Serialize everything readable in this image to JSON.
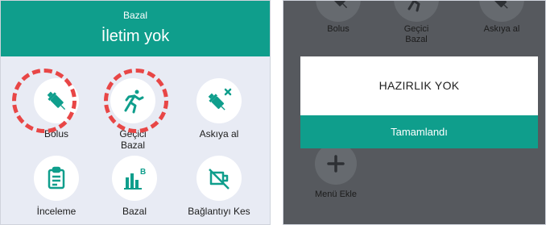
{
  "left": {
    "header_subtitle": "Bazal",
    "header_title": "İletim yok",
    "tiles": [
      {
        "label": "Bolus",
        "icon": "syringe-icon"
      },
      {
        "label": "Geçici",
        "label2": "Bazal",
        "icon": "running-person-icon"
      },
      {
        "label": "Askıya al",
        "icon": "syringe-pause-icon"
      },
      {
        "label": "İnceleme",
        "icon": "clipboard-icon"
      },
      {
        "label": "Bazal",
        "icon": "bar-chart-b-icon"
      },
      {
        "label": "Bağlantıyı Kes",
        "icon": "disconnect-icon"
      }
    ]
  },
  "right": {
    "tiles": [
      {
        "label": "Bolus",
        "icon": "syringe-icon"
      },
      {
        "label": "Geçici",
        "label2": "Bazal",
        "icon": "running-person-icon"
      },
      {
        "label": "Askıya al",
        "icon": "syringe-pause-icon"
      },
      {
        "label": "Menü Ekle",
        "icon": "plus-icon"
      }
    ],
    "dialog": {
      "message": "HAZIRLIK YOK",
      "button": "Tamamlandı"
    }
  },
  "colors": {
    "accent": "#0f9e8c",
    "highlight": "#e84646"
  }
}
